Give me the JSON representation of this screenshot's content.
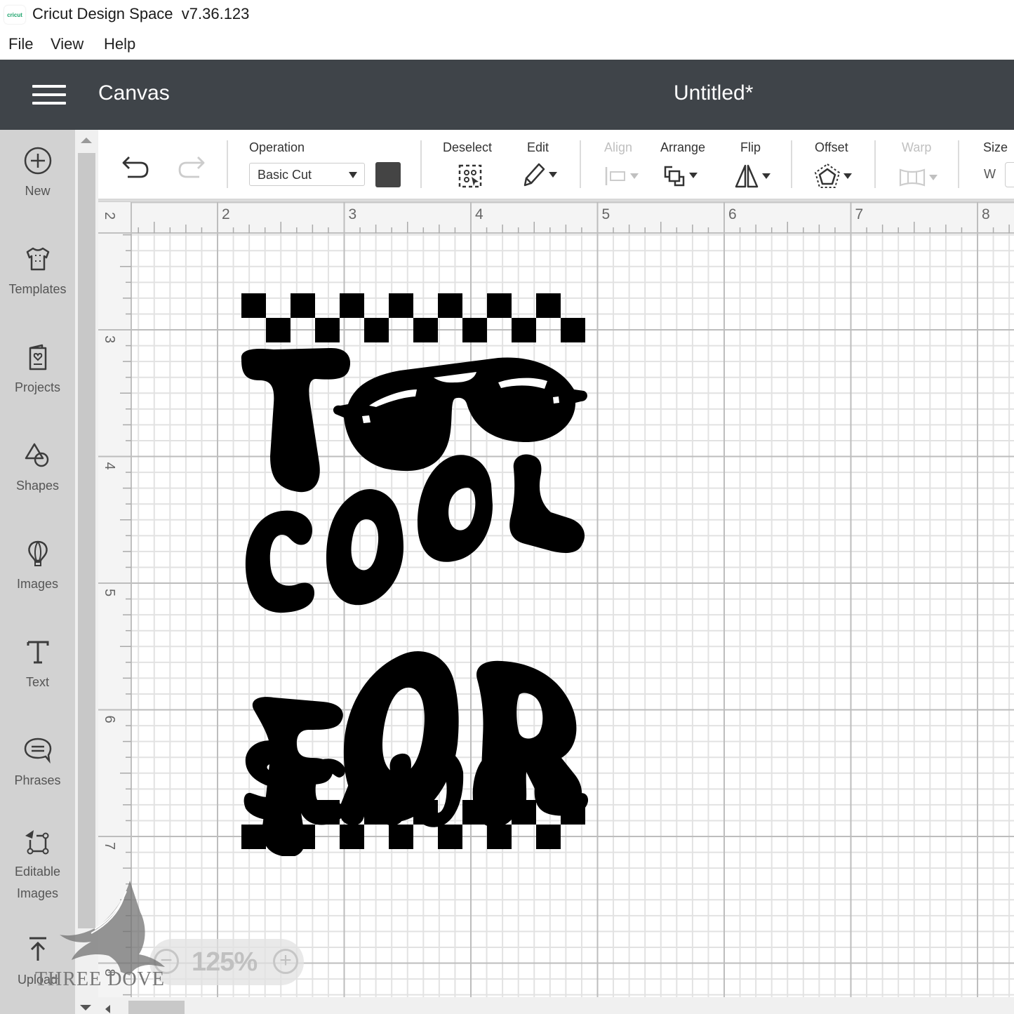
{
  "window": {
    "app_logo_text": "cricut",
    "title": "Cricut Design Space  v7.36.123"
  },
  "menu": [
    "File",
    "View",
    "Help"
  ],
  "header": {
    "section": "Canvas",
    "document_title": "Untitled*"
  },
  "sidebar": {
    "items": [
      {
        "label": "New",
        "icon": "plus-circle-icon"
      },
      {
        "label": "Templates",
        "icon": "tshirt-icon"
      },
      {
        "label": "Projects",
        "icon": "card-heart-icon"
      },
      {
        "label": "Shapes",
        "icon": "shapes-icon"
      },
      {
        "label": "Images",
        "icon": "balloon-icon"
      },
      {
        "label": "Text",
        "icon": "text-t-icon"
      },
      {
        "label": "Phrases",
        "icon": "speech-bubble-icon"
      },
      {
        "label": "Editable Images",
        "icon": "editable-image-icon"
      },
      {
        "label": "Upload",
        "icon": "upload-icon"
      }
    ]
  },
  "toolbar": {
    "undo_icon": "undo-icon",
    "redo_icon": "redo-icon",
    "operation_label": "Operation",
    "operation_value": "Basic Cut",
    "operation_color": "#444444",
    "deselect_label": "Deselect",
    "edit_label": "Edit",
    "align_label": "Align",
    "arrange_label": "Arrange",
    "flip_label": "Flip",
    "offset_label": "Offset",
    "warp_label": "Warp",
    "size_label": "Size",
    "size_w_label": "W"
  },
  "rulers": {
    "horizontal_labels": [
      "2",
      "3",
      "4",
      "5",
      "6",
      "7",
      "8"
    ],
    "vertical_labels": [
      "2",
      "3",
      "4",
      "5",
      "6",
      "7",
      "8"
    ]
  },
  "design": {
    "lines": [
      "TOO",
      "COOL",
      "FOR",
      "SCHOOL"
    ],
    "color": "#000000"
  },
  "zoom": {
    "value": "125%",
    "minus": "−",
    "plus": "+"
  },
  "watermark": {
    "text": "THREE DOVE"
  }
}
